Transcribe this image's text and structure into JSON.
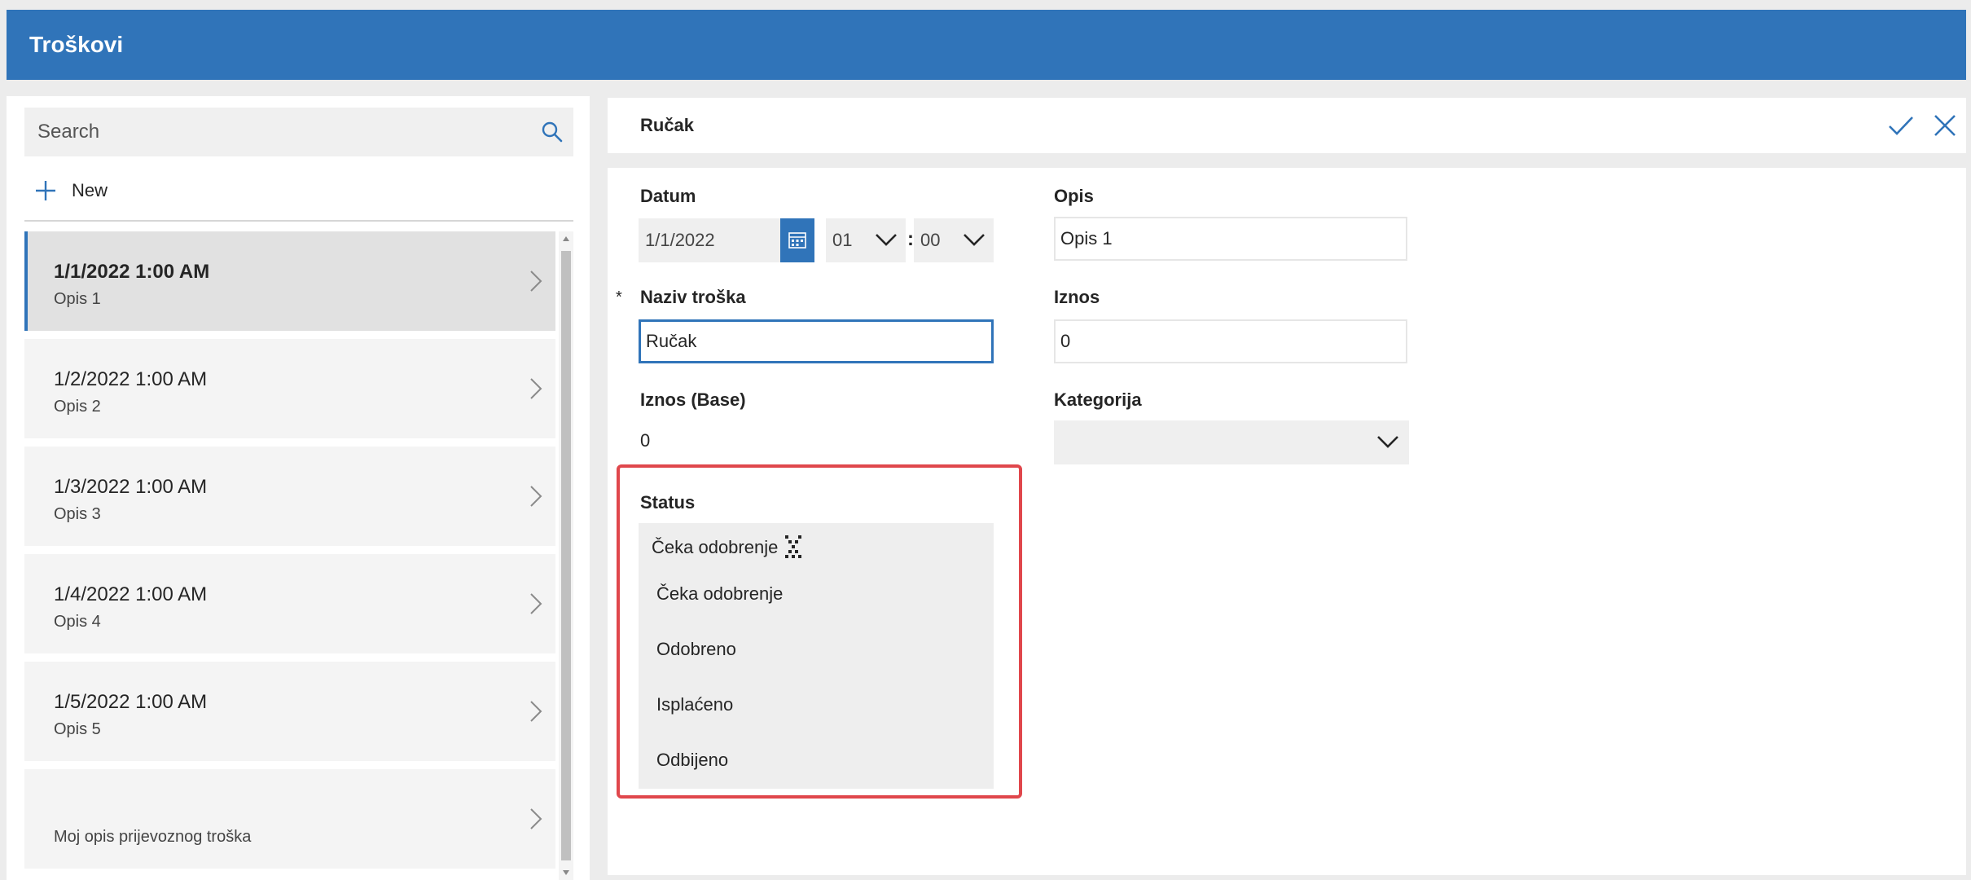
{
  "app": {
    "title": "Troškovi"
  },
  "search": {
    "placeholder": "Search"
  },
  "list": {
    "new_label": "New",
    "items": [
      {
        "title": "1/1/2022 1:00 AM",
        "subtitle": "Opis 1"
      },
      {
        "title": "1/2/2022 1:00 AM",
        "subtitle": "Opis 2"
      },
      {
        "title": "1/3/2022 1:00 AM",
        "subtitle": "Opis 3"
      },
      {
        "title": "1/4/2022 1:00 AM",
        "subtitle": "Opis 4"
      },
      {
        "title": "1/5/2022 1:00 AM",
        "subtitle": "Opis 5"
      },
      {
        "title": "",
        "subtitle": "Moj opis prijevoznog troška"
      }
    ]
  },
  "form": {
    "title": "Ručak",
    "fields": {
      "datum": {
        "label": "Datum",
        "date": "1/1/2022",
        "hour": "01",
        "minute": "00",
        "separator": ":"
      },
      "opis": {
        "label": "Opis",
        "value": "Opis 1"
      },
      "naziv": {
        "label": "Naziv troška",
        "value": "Ručak",
        "required": "*"
      },
      "iznos": {
        "label": "Iznos",
        "value": "0"
      },
      "iznos_base": {
        "label": "Iznos (Base)",
        "value": "0"
      },
      "kategorija": {
        "label": "Kategorija",
        "value": ""
      },
      "status": {
        "label": "Status",
        "current": "Čeka odobrenje",
        "options": [
          "Čeka odobrenje",
          "Odobreno",
          "Isplaćeno",
          "Odbijeno"
        ]
      }
    }
  },
  "colors": {
    "accent": "#3074b9",
    "highlight": "#e0474c"
  }
}
